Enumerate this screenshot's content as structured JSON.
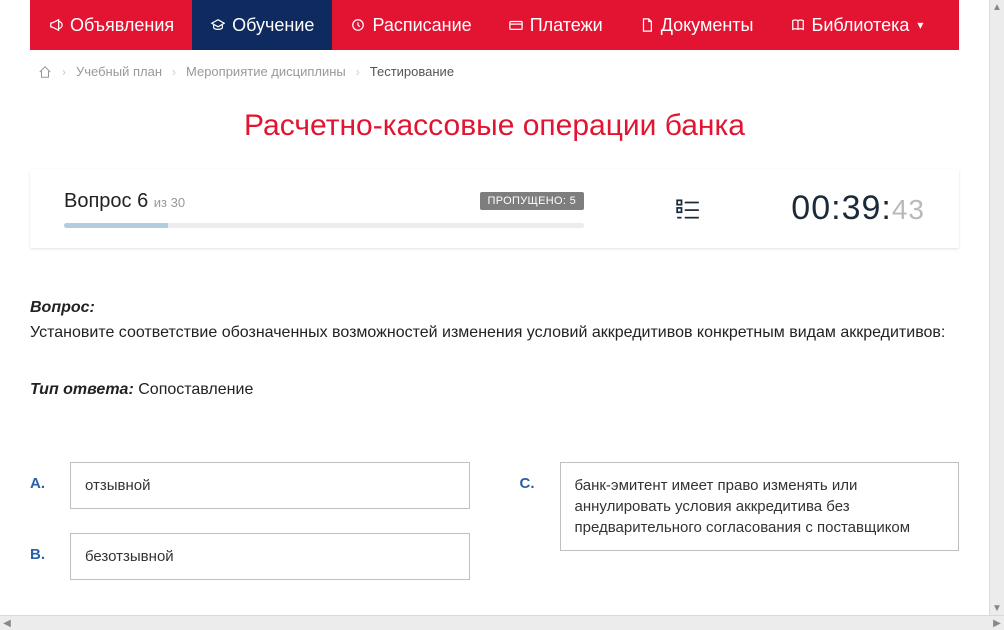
{
  "nav": {
    "items": [
      {
        "label": "Объявления",
        "icon": "megaphone"
      },
      {
        "label": "Обучение",
        "icon": "grad-cap",
        "active": true
      },
      {
        "label": "Расписание",
        "icon": "clock"
      },
      {
        "label": "Платежи",
        "icon": "card"
      },
      {
        "label": "Документы",
        "icon": "doc"
      },
      {
        "label": "Библиотека",
        "icon": "book",
        "dropdown": true
      }
    ]
  },
  "breadcrumbs": {
    "items": [
      "Учебный план",
      "Мероприятие дисциплины"
    ],
    "current": "Тестирование"
  },
  "title": "Расчетно-кассовые операции банка",
  "progress": {
    "question_label": "Вопрос",
    "current": "6",
    "of_label": "из",
    "total": "30",
    "skipped_label": "ПРОПУЩЕНО:",
    "skipped_count": "5"
  },
  "timer": {
    "mm": "00",
    "ss": "39",
    "cs": "43"
  },
  "question": {
    "label": "Вопрос:",
    "text": "Установите соответствие обозначенных возможностей изменения условий аккредитивов конкретным видам аккредитивов:",
    "answer_type_label": "Тип ответа:",
    "answer_type": "Сопоставление"
  },
  "answers": {
    "left": [
      {
        "letter": "A.",
        "text": "отзывной"
      },
      {
        "letter": "B.",
        "text": "безотзывной"
      }
    ],
    "right": [
      {
        "letter": "C.",
        "text": "банк-эмитент имеет право изменять или аннулировать условия аккредитива без предварительного согласования с поставщиком"
      }
    ]
  }
}
